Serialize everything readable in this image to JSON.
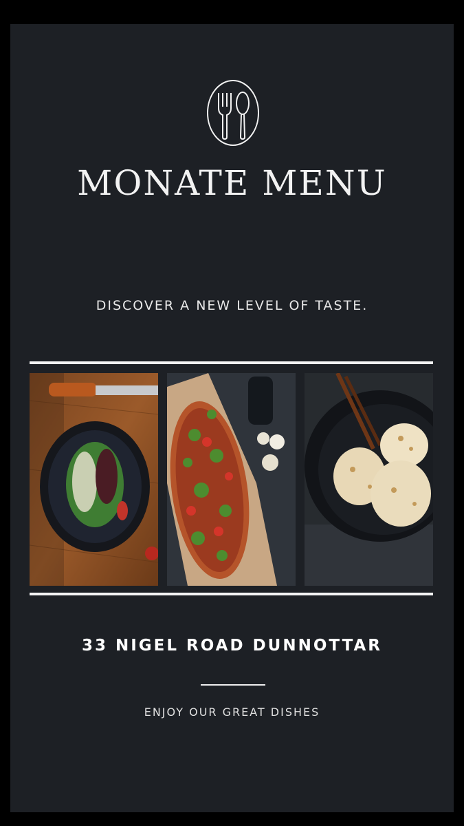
{
  "logo": {
    "icon": "fork-spoon-icon"
  },
  "title": "MONATE MENU",
  "tagline": "DISCOVER A NEW LEVEL OF TASTE.",
  "photos": [
    {
      "subject": "salad-plate-photo"
    },
    {
      "subject": "pizza-photo"
    },
    {
      "subject": "ice-cream-bowl-photo"
    }
  ],
  "address": "33 NIGEL ROAD DUNNOTTAR",
  "footer": "ENJOY OUR GREAT DISHES",
  "colors": {
    "background": "#1d2025",
    "outer_border": "#000000",
    "text": "#ffffff",
    "rule": "#f4f4f4"
  }
}
